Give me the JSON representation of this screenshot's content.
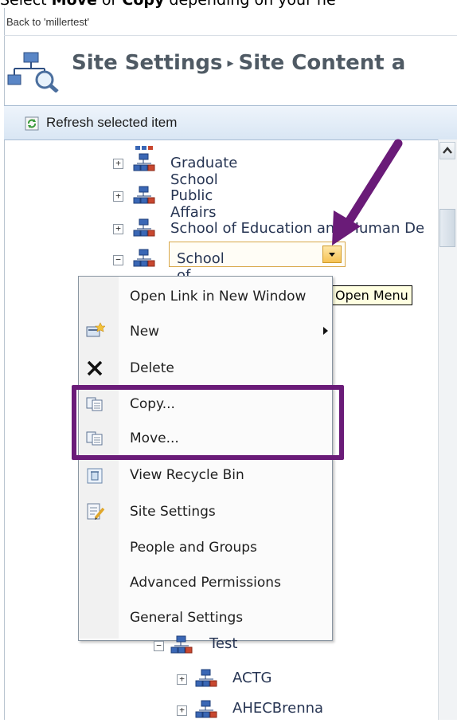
{
  "instruction": {
    "prefix": "Select ",
    "bold1": "Move",
    "mid": " or ",
    "bold2": "Copy",
    "suffix": " depending on your ne"
  },
  "nav": {
    "back_link": "Back to 'millertest'"
  },
  "page": {
    "title_part1": "Site Settings",
    "title_separator": "▸",
    "title_part2": "Site Content a"
  },
  "toolbar": {
    "refresh_label": "Refresh selected item"
  },
  "tree": {
    "items": [
      {
        "label": "Graduate School",
        "expander": "+"
      },
      {
        "label": "Public Affairs",
        "expander": "+"
      },
      {
        "label": "School of Education and Human De",
        "expander": "+"
      },
      {
        "label": "School of Medicine",
        "expander": "−"
      }
    ],
    "children": [
      {
        "label": "Test",
        "expander": "−"
      },
      {
        "label": "ACTG",
        "expander": "+"
      },
      {
        "label": "AHECBrenna",
        "expander": "+"
      }
    ]
  },
  "tooltip": "Open Menu",
  "context_menu": {
    "items": [
      {
        "label": "Open Link in New Window",
        "icon": "none"
      },
      {
        "label": "New",
        "icon": "new-site-icon",
        "has_submenu": true
      },
      {
        "label": "Delete",
        "icon": "delete-icon"
      },
      {
        "label": "Copy...",
        "icon": "copy-icon"
      },
      {
        "label": "Move...",
        "icon": "move-icon"
      },
      {
        "label": "View Recycle Bin",
        "icon": "recycle-bin-icon"
      },
      {
        "label": "Site Settings",
        "icon": "site-settings-icon"
      },
      {
        "label": "People and Groups",
        "icon": "none"
      },
      {
        "label": "Advanced Permissions",
        "icon": "none"
      },
      {
        "label": "General Settings",
        "icon": "none"
      }
    ]
  },
  "colors": {
    "annotation_purple": "#6a1b78",
    "selection_orange": "#f6c253",
    "toolbar_blue": "#d9e6f4"
  }
}
